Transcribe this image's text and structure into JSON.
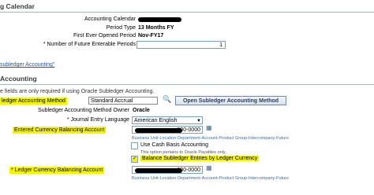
{
  "calendar_section": {
    "title": "g Calendar",
    "fields": [
      {
        "label": "Accounting Calendar",
        "value": ""
      },
      {
        "label": "Period Type",
        "value": "13 Months FY"
      },
      {
        "label": "First Ever Opened Period",
        "value": "Nov-FY17"
      }
    ],
    "future_periods": {
      "label": "* Number of Future Enterable Periods",
      "value": "1"
    }
  },
  "subledger_link": "subledger Accounting\"",
  "accounting_section": {
    "title": "Accounting",
    "info_text": "e fields are only required if using Oracle Subledger Accounting.",
    "method": {
      "label": "ledger Accounting Method",
      "value": "Standard Accrual"
    },
    "open_button": "Open Subledger Accounting Method",
    "method_owner": {
      "label": "Subledger Accounting Method Owner",
      "value": "Oracle"
    },
    "journal_language": {
      "label": "* Journal Entry Language",
      "value": "American English"
    },
    "entered_balancing": {
      "label": "Entered Currency Balancing Account",
      "value": "000-0000"
    },
    "segment_hint": "Business Unit-Location-Department-Account-Product Group-Intercompany-Future",
    "cash_basis": {
      "label": "Use Cash Basis Accounting",
      "checked": false
    },
    "cash_basis_note": "This option pertains to Oracle Payables only.",
    "balance_subledger": {
      "label": "Balance Subledger Entries by Ledger Currency",
      "checked": true
    },
    "ledger_balancing": {
      "label": "* Ledger Currency Balancing Account",
      "value": "000-0000"
    },
    "segment_hint_2": "Business Unit-Location-Department-Account-Product Group-Intercompany-Future"
  },
  "colors": {
    "highlight": "#f4f400",
    "header_text": "#3c3c3c",
    "link": "#2a4fa0"
  }
}
